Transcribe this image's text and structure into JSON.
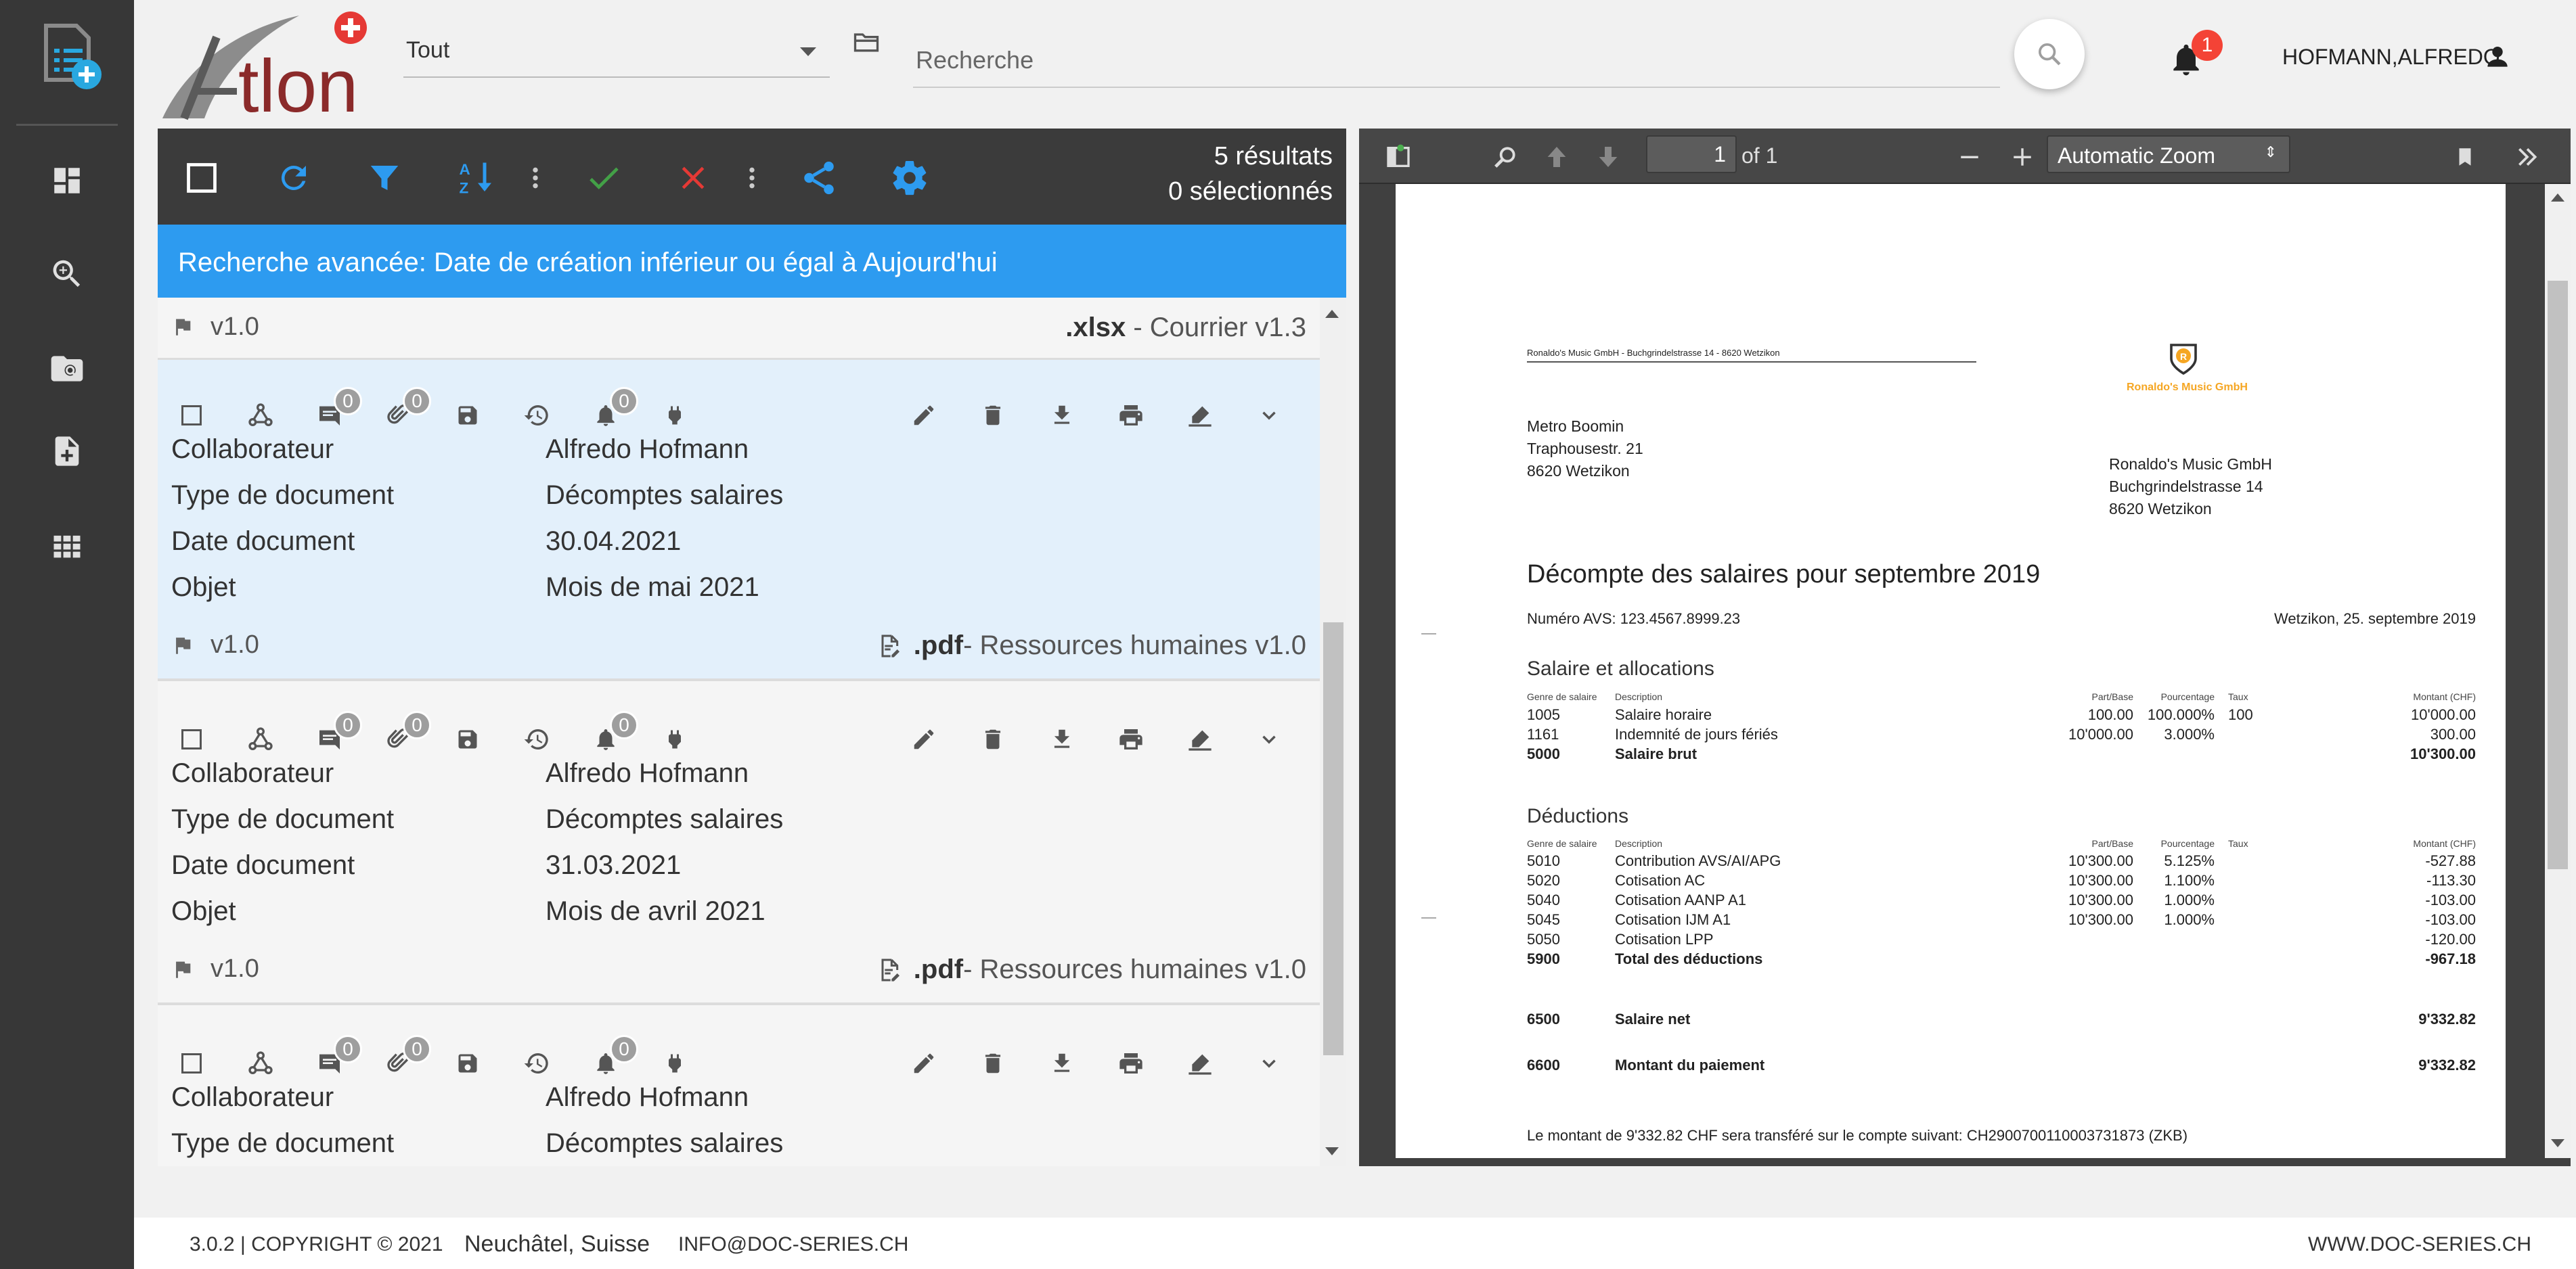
{
  "header": {
    "filter_value": "Tout",
    "search_placeholder": "Recherche",
    "notification_count": "1",
    "user_name": "HOFMANN,ALFREDO"
  },
  "list": {
    "results": "5 résultats",
    "selected": "0 sélectionnés",
    "advanced_search": "Recherche avancée: Date de création inférieur ou égal à Aujourd'hui",
    "top_row": {
      "version": "v1.0",
      "ext": ".xlsx",
      "type": " - Courrier v1.3"
    },
    "labels": {
      "collaborateur": "Collaborateur",
      "type": "Type de document",
      "date": "Date document",
      "objet": "Objet"
    },
    "badge_zero": "0",
    "cards": [
      {
        "collaborateur": "Alfredo Hofmann",
        "type": "Décomptes salaires",
        "date": "30.04.2021",
        "objet": "Mois de mai 2021",
        "version": "v1.0",
        "ext": ".pdf",
        "category": " - Ressources humaines v1.0"
      },
      {
        "collaborateur": "Alfredo Hofmann",
        "type": "Décomptes salaires",
        "date": "31.03.2021",
        "objet": "Mois de avril 2021",
        "version": "v1.0",
        "ext": ".pdf",
        "category": " - Ressources humaines v1.0"
      },
      {
        "collaborateur": "Alfredo Hofmann",
        "type": "Décomptes salaires"
      }
    ]
  },
  "pdf": {
    "page": "1",
    "of": "of 1",
    "zoom": "Automatic Zoom",
    "doc": {
      "sender_line": "Ronaldo's Music GmbH - Buchgrindelstrasse 14 - 8620 Wetzikon",
      "logo_letter": "R",
      "logo_text": "Ronaldo's Music GmbH",
      "recipient": [
        "Metro Boomin",
        "Traphousestr. 21",
        "8620 Wetzikon"
      ],
      "company": [
        "Ronaldo's Music GmbH",
        "Buchgrindelstrasse 14",
        "8620 Wetzikon"
      ],
      "title": "Décompte des salaires pour septembre 2019",
      "avs": "Numéro AVS: 123.4567.8999.23",
      "place_date": "Wetzikon, 25. septembre 2019",
      "section1": "Salaire et allocations",
      "section2": "Déductions",
      "col_headers": {
        "genre": "Genre de salaire",
        "desc": "Description",
        "base": "Part/Base",
        "pct": "Pourcentage",
        "taux": "Taux",
        "montant": "Montant (CHF)"
      },
      "rows1": [
        {
          "code": "1005",
          "desc": "Salaire horaire",
          "base": "100.00",
          "pct": "100.000%",
          "taux": "100",
          "amount": "10'000.00",
          "bold": false
        },
        {
          "code": "1161",
          "desc": "Indemnité de jours fériés",
          "base": "10'000.00",
          "pct": "3.000%",
          "taux": "",
          "amount": "300.00",
          "bold": false
        },
        {
          "code": "5000",
          "desc": "Salaire brut",
          "base": "",
          "pct": "",
          "taux": "",
          "amount": "10'300.00",
          "bold": true
        }
      ],
      "rows2": [
        {
          "code": "5010",
          "desc": "Contribution AVS/AI/APG",
          "base": "10'300.00",
          "pct": "5.125%",
          "amount": "-527.88",
          "bold": false
        },
        {
          "code": "5020",
          "desc": "Cotisation AC",
          "base": "10'300.00",
          "pct": "1.100%",
          "amount": "-113.30",
          "bold": false
        },
        {
          "code": "5040",
          "desc": "Cotisation AANP A1",
          "base": "10'300.00",
          "pct": "1.000%",
          "amount": "-103.00",
          "bold": false
        },
        {
          "code": "5045",
          "desc": "Cotisation IJM A1",
          "base": "10'300.00",
          "pct": "1.000%",
          "amount": "-103.00",
          "bold": false
        },
        {
          "code": "5050",
          "desc": "Cotisation LPP",
          "base": "",
          "pct": "",
          "amount": "-120.00",
          "bold": false
        },
        {
          "code": "5900",
          "desc": "Total des déductions",
          "base": "",
          "pct": "",
          "amount": "-967.18",
          "bold": true
        }
      ],
      "net": {
        "code": "6500",
        "desc": "Salaire net",
        "amount": "9'332.82"
      },
      "payment": {
        "code": "6600",
        "desc": "Montant du paiement",
        "amount": "9'332.82"
      },
      "transfer_note": "Le montant de 9'332.82 CHF sera transféré sur le compte suivant: CH2900700110003731873 (ZKB)"
    }
  },
  "footer": {
    "copyright": "3.0.2 | COPYRIGHT © 2021",
    "location": "Neuchâtel, Suisse",
    "email": "INFO@DOC-SERIES.CH",
    "website": "WWW.DOC-SERIES.CH"
  },
  "colors": {
    "accent": "#2d9bf0",
    "toolbar": "#3b3b3b",
    "selected_card": "#e3f0fb",
    "rail": "#373737",
    "approve": "#43a047",
    "reject": "#e53935"
  }
}
